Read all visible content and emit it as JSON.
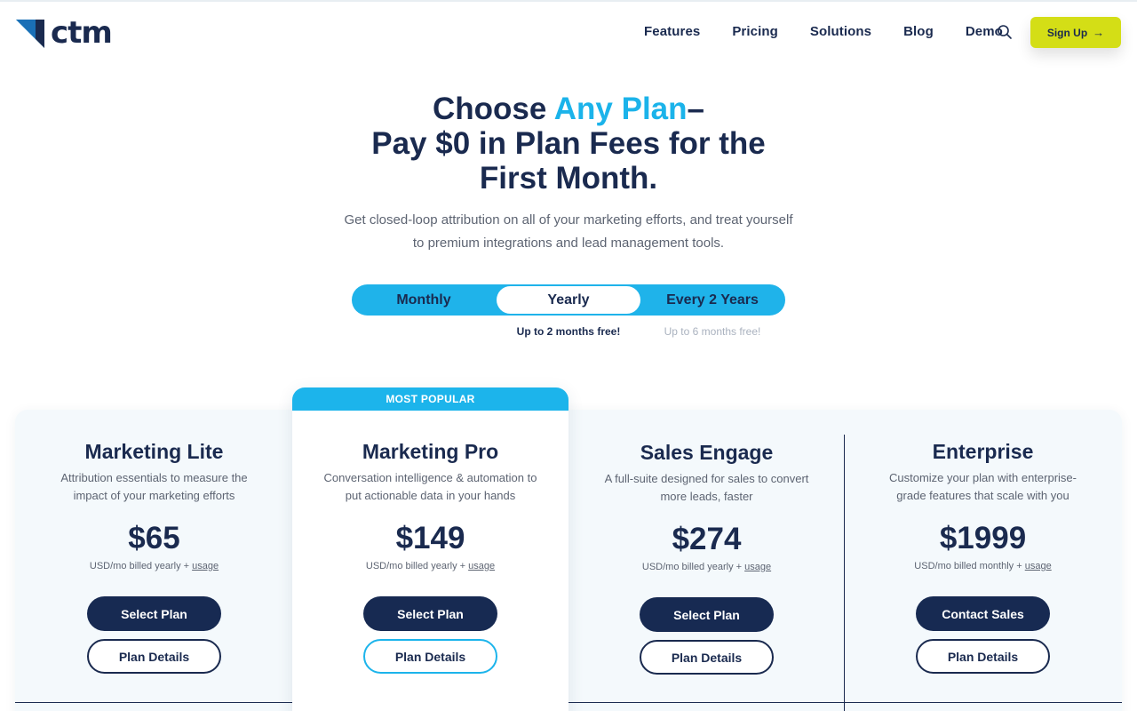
{
  "colors": {
    "accent": "#1bb3ea",
    "navy": "#1a2a4f",
    "cta": "#d4de16"
  },
  "brand": {
    "name": "ctm"
  },
  "nav": {
    "items": [
      "Features",
      "Pricing",
      "Solutions",
      "Blog",
      "Demo"
    ],
    "signup_label": "Sign Up"
  },
  "hero": {
    "title_part1": "Choose ",
    "title_accent": "Any Plan",
    "title_part2": "–",
    "title_line2": "Pay $0 in Plan Fees for the",
    "title_line3": "First Month.",
    "subtitle_line1": "Get closed-loop attribution on all of your marketing efforts, and treat yourself",
    "subtitle_line2": "to premium integrations and lead management tools."
  },
  "billing_toggle": {
    "options": [
      "Monthly",
      "Yearly",
      "Every 2 Years"
    ],
    "selected": "Yearly",
    "note_yearly": "Up to 2 months free!",
    "note_two_years": "Up to 6 months free!"
  },
  "plans": [
    {
      "name": "Marketing Lite",
      "desc_line1": "Attribution essentials to measure the",
      "desc_line2": "impact of your marketing efforts",
      "price": "$65",
      "billing": "USD/mo billed yearly + ",
      "usage": "usage",
      "primary": "Select Plan",
      "secondary": "Plan Details"
    },
    {
      "name": "Marketing Pro",
      "badge": "MOST POPULAR",
      "desc_line1": "Conversation intelligence & automation to",
      "desc_line2": "put actionable data in your hands",
      "price": "$149",
      "billing": "USD/mo billed yearly + ",
      "usage": "usage",
      "primary": "Select Plan",
      "secondary": "Plan Details"
    },
    {
      "name": "Sales Engage",
      "desc_line1": "A full-suite designed for sales to convert",
      "desc_line2": "more leads, faster",
      "price": "$274",
      "billing": "USD/mo billed yearly + ",
      "usage": "usage",
      "primary": "Select Plan",
      "secondary": "Plan Details"
    },
    {
      "name": "Enterprise",
      "desc_line1": "Customize your plan with enterprise-",
      "desc_line2": "grade features that scale with you",
      "price": "$1999",
      "billing": "USD/mo billed monthly + ",
      "usage": "usage",
      "primary": "Contact Sales",
      "secondary": "Plan Details"
    }
  ]
}
